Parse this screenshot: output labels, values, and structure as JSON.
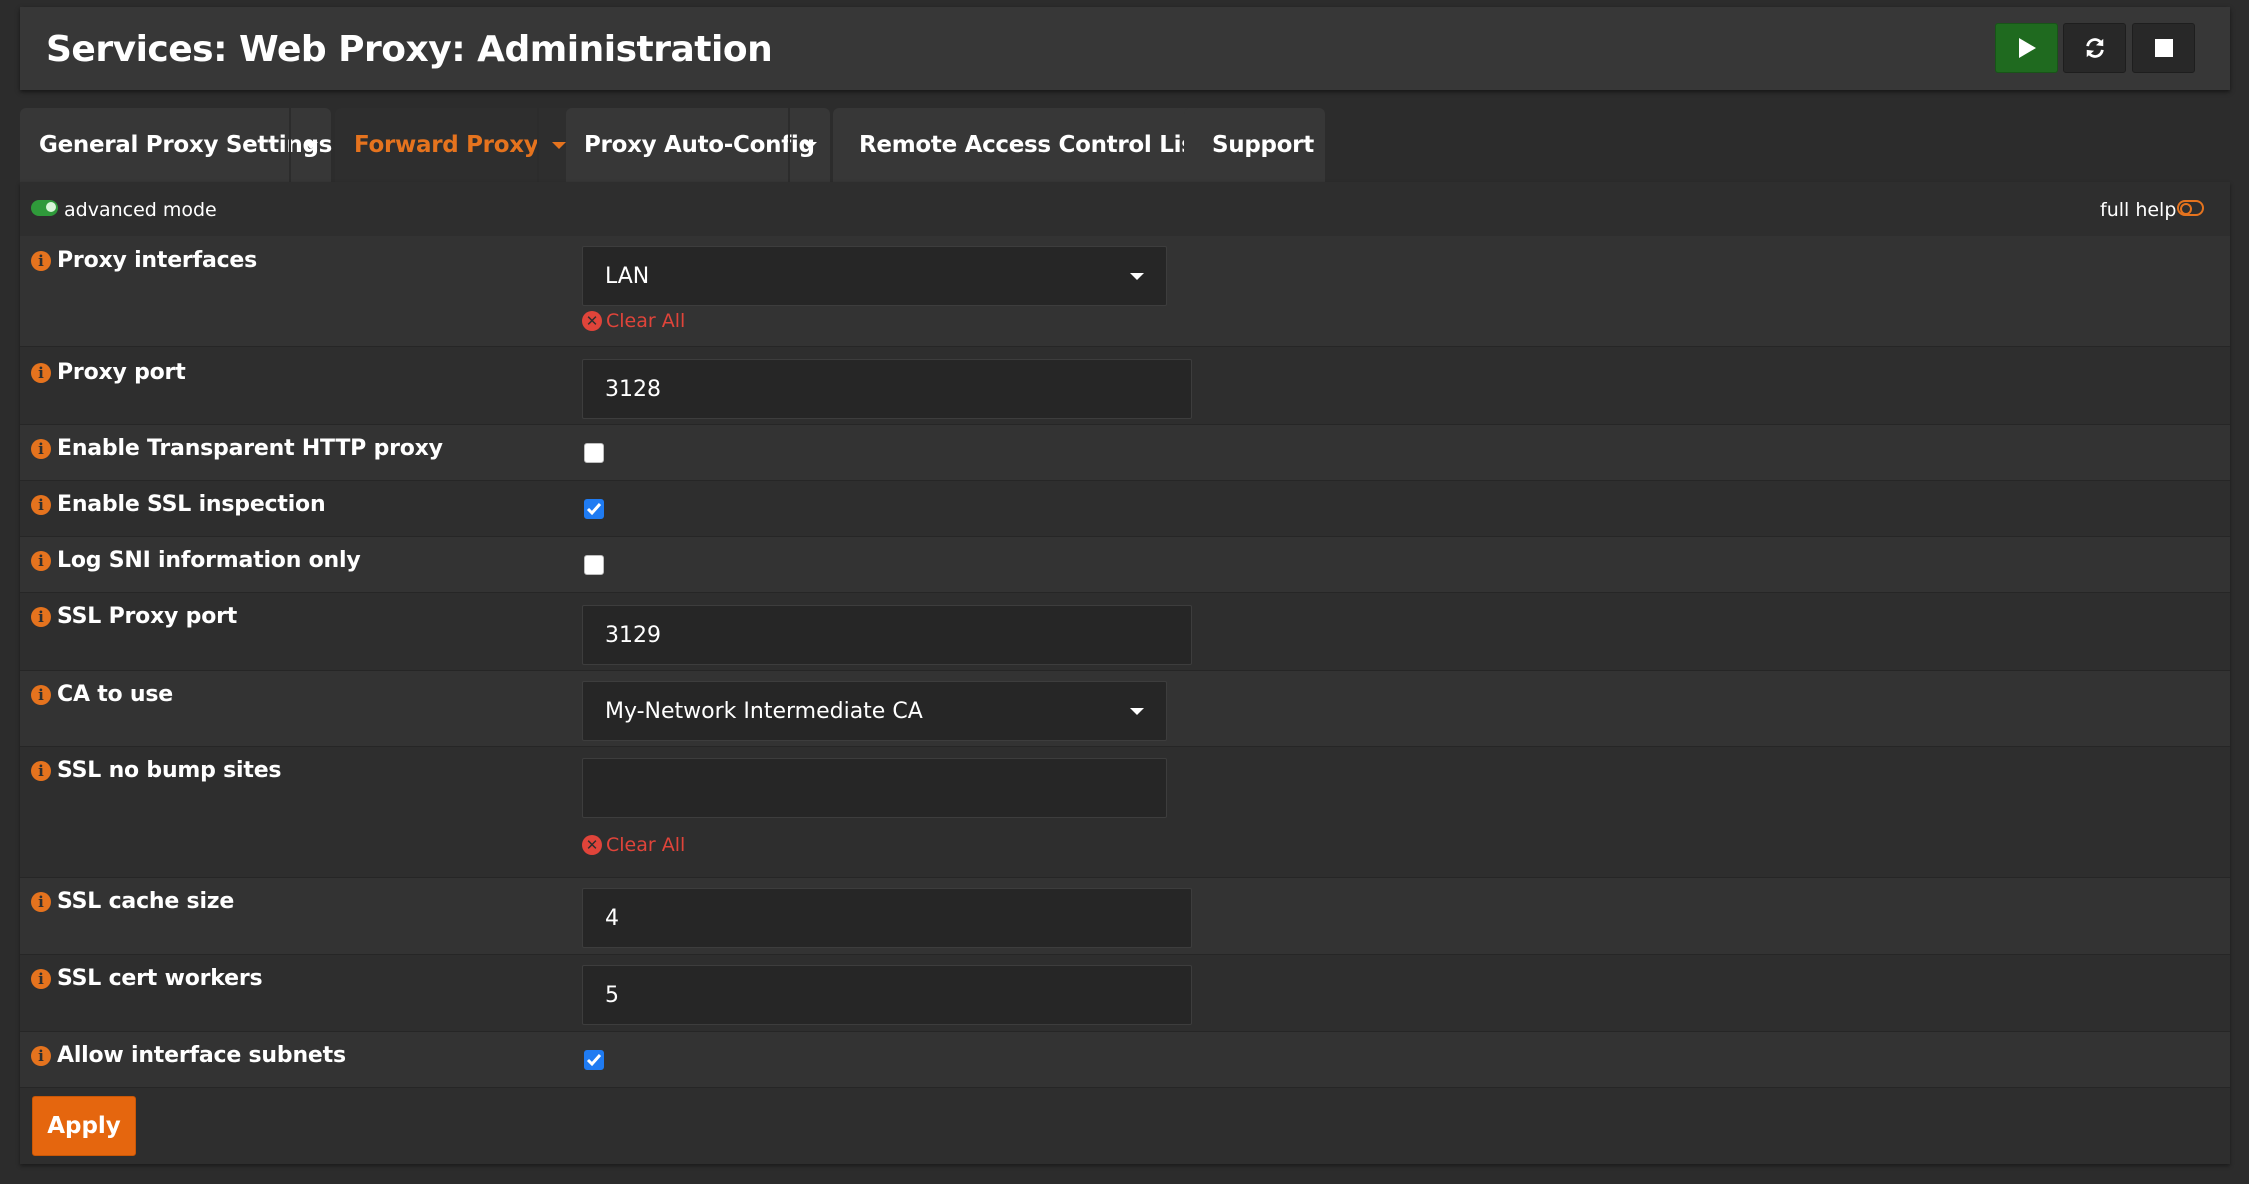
{
  "header": {
    "title": "Services: Web Proxy: Administration",
    "buttons": [
      "play-icon",
      "refresh-icon",
      "stop-icon"
    ],
    "start_color": "#1f6a1f"
  },
  "tabs": [
    {
      "label": "General Proxy Settings",
      "dropdown": true,
      "active": false
    },
    {
      "label": "Forward Proxy",
      "dropdown": true,
      "active": true
    },
    {
      "label": "Proxy Auto-Config",
      "dropdown": true,
      "active": false
    },
    {
      "label": "Remote Access Control Lists",
      "dropdown": false,
      "active": false
    },
    {
      "label": "Support",
      "dropdown": false,
      "active": false
    }
  ],
  "toolbar": {
    "advanced_mode_label": "advanced mode",
    "advanced_mode_on": true,
    "full_help_label": "full help",
    "full_help_on": false
  },
  "form": {
    "proxy_interfaces": {
      "label": "Proxy interfaces",
      "value": "LAN",
      "clear_label": "Clear All"
    },
    "proxy_port": {
      "label": "Proxy port",
      "value": "3128"
    },
    "transparent_http": {
      "label": "Enable Transparent HTTP proxy",
      "checked": false
    },
    "ssl_inspection": {
      "label": "Enable SSL inspection",
      "checked": true
    },
    "log_sni": {
      "label": "Log SNI information only",
      "checked": false
    },
    "ssl_proxy_port": {
      "label": "SSL Proxy port",
      "value": "3129"
    },
    "ca_to_use": {
      "label": "CA to use",
      "value": "My-Network Intermediate CA"
    },
    "ssl_no_bump": {
      "label": "SSL no bump sites",
      "value": "",
      "clear_label": "Clear All"
    },
    "ssl_cache_size": {
      "label": "SSL cache size",
      "value": "4"
    },
    "ssl_cert_workers": {
      "label": "SSL cert workers",
      "value": "5"
    },
    "allow_subnets": {
      "label": "Allow interface subnets",
      "checked": true
    }
  },
  "apply_label": "Apply",
  "accent_color": "#e5731e"
}
